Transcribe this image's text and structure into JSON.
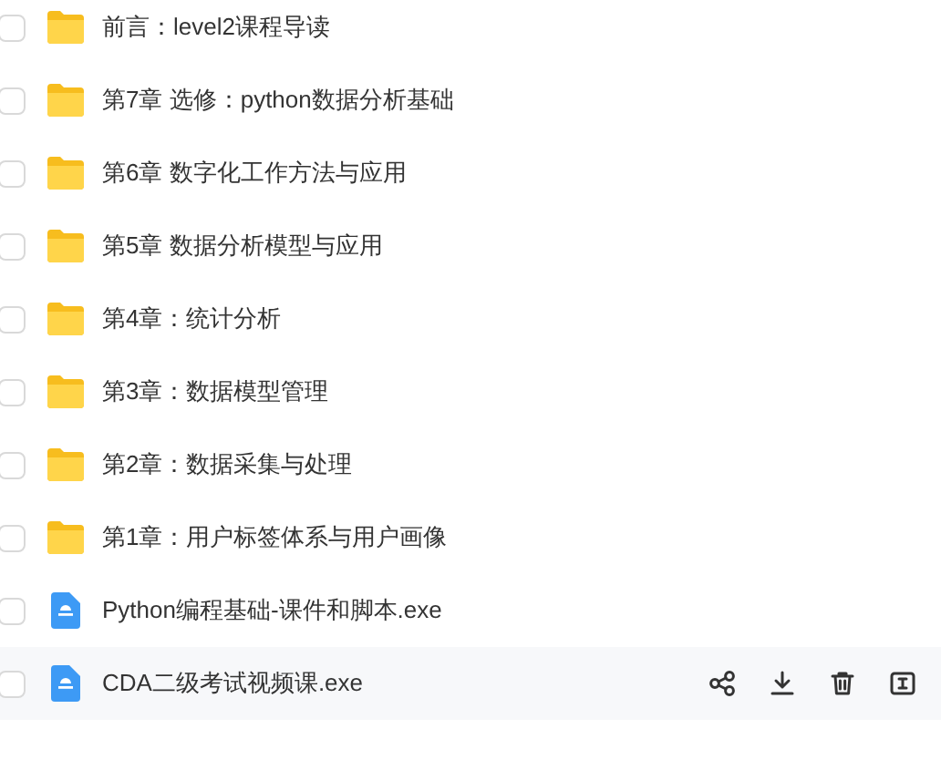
{
  "files": [
    {
      "kind": "folder",
      "name": "前言：level2课程导读",
      "checked": false,
      "hovered": false
    },
    {
      "kind": "folder",
      "name": "第7章 选修：python数据分析基础",
      "checked": false,
      "hovered": false
    },
    {
      "kind": "folder",
      "name": "第6章 数字化工作方法与应用",
      "checked": false,
      "hovered": false
    },
    {
      "kind": "folder",
      "name": "第5章 数据分析模型与应用",
      "checked": false,
      "hovered": false
    },
    {
      "kind": "folder",
      "name": "第4章：统计分析",
      "checked": false,
      "hovered": false
    },
    {
      "kind": "folder",
      "name": "第3章：数据模型管理",
      "checked": false,
      "hovered": false
    },
    {
      "kind": "folder",
      "name": "第2章：数据采集与处理",
      "checked": false,
      "hovered": false
    },
    {
      "kind": "folder",
      "name": "第1章：用户标签体系与用户画像",
      "checked": false,
      "hovered": false
    },
    {
      "kind": "exe",
      "name": "Python编程基础-课件和脚本.exe",
      "checked": false,
      "hovered": false
    },
    {
      "kind": "exe",
      "name": "CDA二级考试视频课.exe",
      "checked": false,
      "hovered": true
    }
  ]
}
